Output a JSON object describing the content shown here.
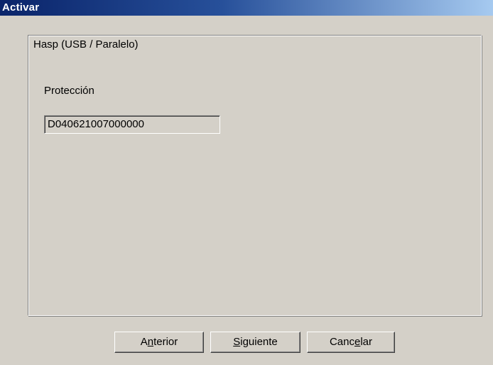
{
  "window": {
    "title": "Activar"
  },
  "group": {
    "legend": "Hasp (USB / Paralelo)",
    "field_label": "Protección",
    "field_value": "D040621007000000"
  },
  "buttons": {
    "back": {
      "pre": "A",
      "mnemonic": "n",
      "post": "terior"
    },
    "next": {
      "pre": "",
      "mnemonic": "S",
      "post": "iguiente"
    },
    "cancel": {
      "pre": "Canc",
      "mnemonic": "e",
      "post": "lar"
    }
  },
  "colors": {
    "face": "#d4d0c8",
    "title_start": "#0a246a",
    "title_end": "#a6caf0",
    "title_text": "#ffffff"
  }
}
